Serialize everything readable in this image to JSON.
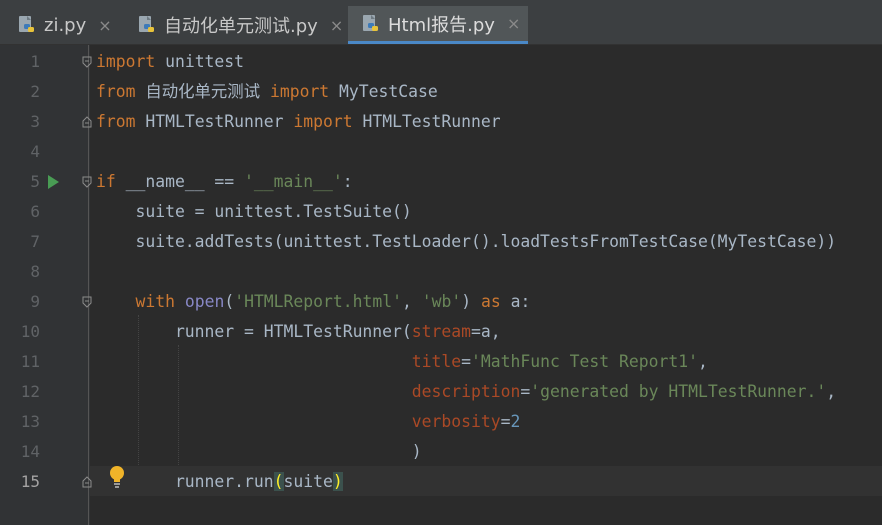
{
  "tabs": [
    {
      "label": "zi.py",
      "active": false,
      "close": "×"
    },
    {
      "label": "自动化单元测试.py",
      "active": false,
      "close": "×"
    },
    {
      "label": "Html报告.py",
      "active": true,
      "close": "×"
    }
  ],
  "current_line": 15,
  "line_numbers": [
    "1",
    "2",
    "3",
    "4",
    "5",
    "6",
    "7",
    "8",
    "9",
    "10",
    "11",
    "12",
    "13",
    "14",
    "15"
  ],
  "code": {
    "l1": {
      "kw": "import",
      "rest": " unittest"
    },
    "l2": {
      "kw1": "from",
      "mod": " 自动化单元测试 ",
      "kw2": "import",
      "rest": " MyTestCase"
    },
    "l3": {
      "kw1": "from",
      "mod": " HTMLTestRunner ",
      "kw2": "import",
      "rest": " HTMLTestRunner"
    },
    "l5": {
      "kw": "if",
      "a": " __name__ == ",
      "str": "'__main__'",
      "b": ":"
    },
    "l6": {
      "text": "    suite = unittest.TestSuite()"
    },
    "l7": {
      "text": "    suite.addTests(unittest.TestLoader().loadTestsFromTestCase(MyTestCase))"
    },
    "l9": {
      "indent": "    ",
      "kw": "with",
      "sp": " ",
      "bi": "open",
      "a": "(",
      "s1": "'HTMLReport.html'",
      "c": ", ",
      "s2": "'wb'",
      "b": ") ",
      "kw2": "as",
      "rest": " a:"
    },
    "l10": {
      "a": "        runner = HTMLTestRunner(",
      "p": "stream",
      "b": "=a,"
    },
    "l11": {
      "indent": "                                ",
      "p": "title",
      "eq": "=",
      "s": "'MathFunc Test Report1'",
      "c": ","
    },
    "l12": {
      "indent": "                                ",
      "p": "description",
      "eq": "=",
      "s": "'generated by HTMLTestRunner.'",
      "c": ","
    },
    "l13": {
      "indent": "                                ",
      "p": "verbosity",
      "eq": "=",
      "n": "2"
    },
    "l14": {
      "text": "                                )"
    },
    "l15": {
      "a": "        runner.run",
      "br1": "(",
      "arg": "suite",
      "br2": ")"
    }
  },
  "icons": {
    "tab_file": "python-file-icon",
    "run": "run-arrow-icon",
    "fold": "fold-marker-icon",
    "intention": "lightbulb-icon"
  },
  "colors": {
    "background": "#2b2b2b",
    "gutter": "#313335",
    "keyword": "#cc7832",
    "string": "#6a8759",
    "number": "#6897bb",
    "parameter": "#aa4926",
    "builtin": "#8888c6",
    "text": "#a9b7c6",
    "run_green": "#499c54",
    "tab_accent": "#4a88c7"
  }
}
